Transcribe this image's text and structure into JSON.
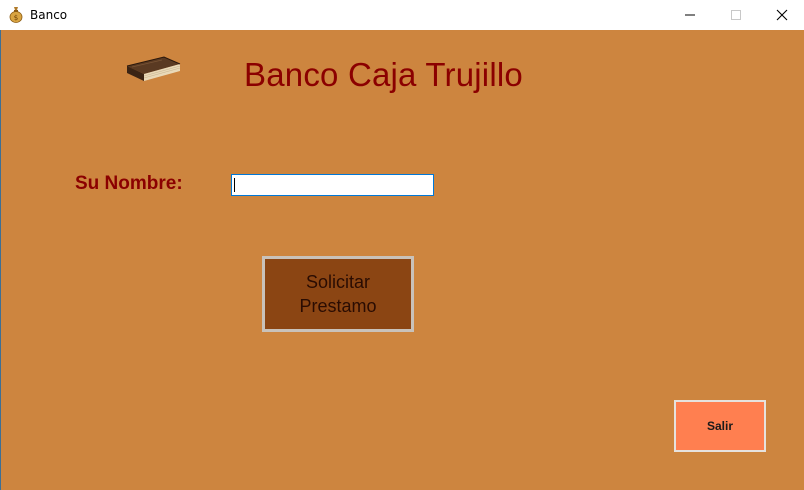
{
  "window": {
    "title": "Banco",
    "app_icon": "money-bag-icon",
    "controls": [
      "minimize-icon",
      "maximize-icon",
      "close-icon"
    ]
  },
  "form": {
    "background_color": "#CD853F",
    "image": "book-icon",
    "heading": "Banco Caja Trujillo",
    "heading_color": "#8B0000",
    "name_label": "Su Nombre:",
    "name_value": "",
    "loan_button_label": "Solicitar\nPrestamo",
    "loan_button_color": "#8B4513",
    "exit_button_label": "Salir",
    "exit_button_color": "#FF7F50"
  }
}
